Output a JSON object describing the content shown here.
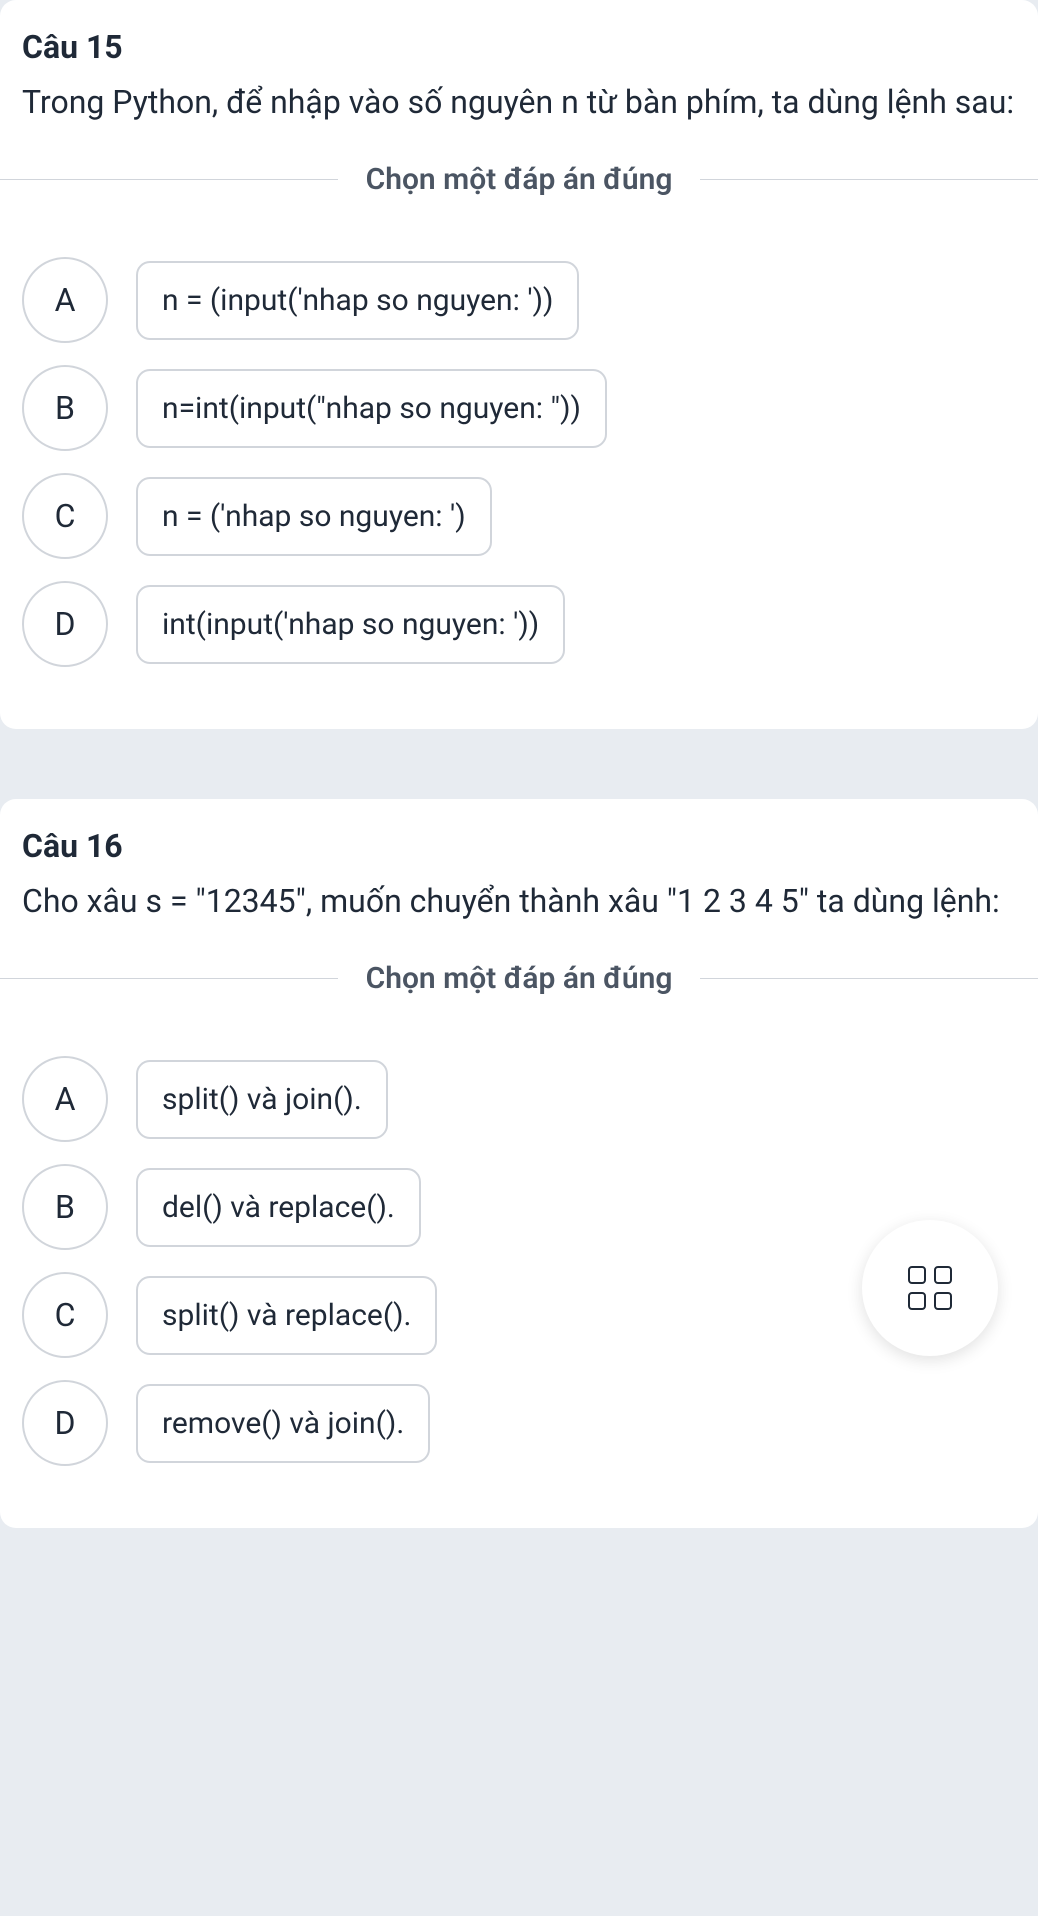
{
  "questions": [
    {
      "number": "Câu 15",
      "text": "Trong Python, để nhập vào số nguyên n từ bàn phím, ta dùng lệnh sau:",
      "instruction": "Chọn một đáp án đúng",
      "options": [
        {
          "letter": "A",
          "content": "n = (input('nhap so nguyen: '))"
        },
        {
          "letter": "B",
          "content": "n=int(input(\"nhap so nguyen: \"))"
        },
        {
          "letter": "C",
          "content": "n = ('nhap so nguyen: ')"
        },
        {
          "letter": "D",
          "content": "int(input('nhap so nguyen: '))"
        }
      ]
    },
    {
      "number": "Câu 16",
      "text": "Cho xâu s = \"12345\", muốn chuyển thành xâu \"1 2 3 4 5\" ta dùng lệnh:",
      "instruction": "Chọn một đáp án đúng",
      "options": [
        {
          "letter": "A",
          "content": "split() và join()."
        },
        {
          "letter": "B",
          "content": "del() và replace()."
        },
        {
          "letter": "C",
          "content": "split() và replace()."
        },
        {
          "letter": "D",
          "content": "remove() và join()."
        }
      ]
    }
  ],
  "fab": {
    "icon": "grid-icon"
  }
}
